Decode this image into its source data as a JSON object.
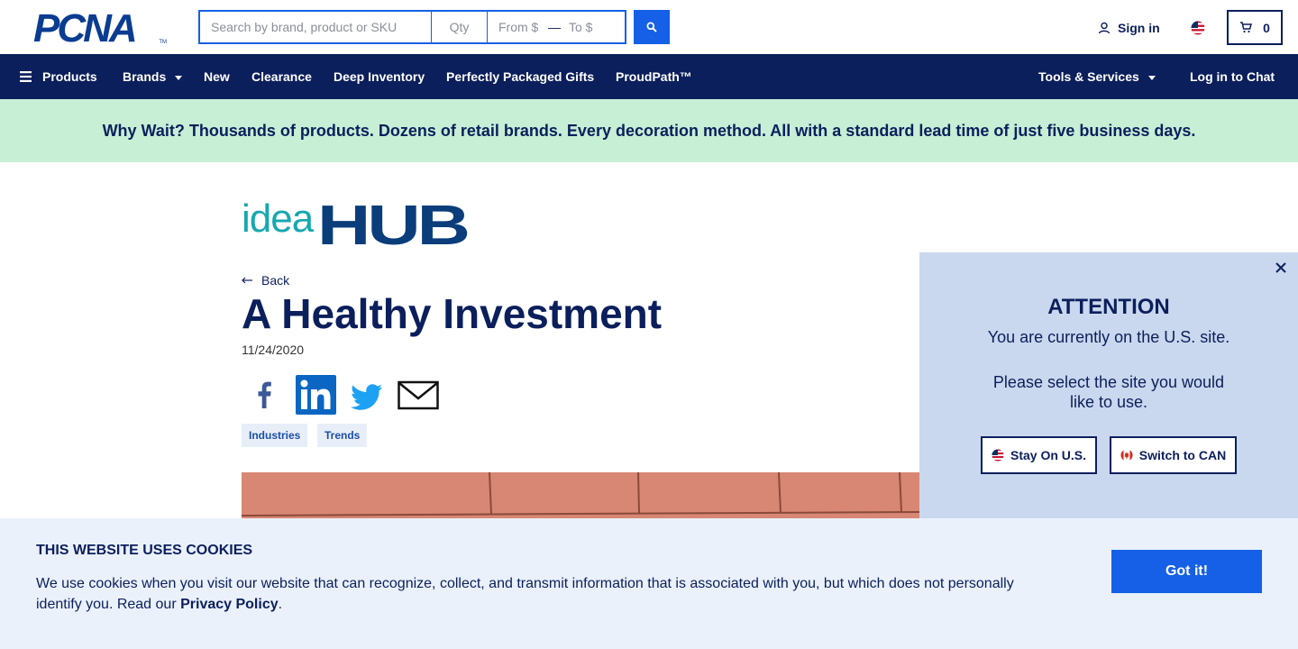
{
  "header": {
    "logo_text": "PCNA",
    "logo_tm": "TM",
    "search": {
      "placeholder": "Search by brand, product or SKU",
      "value": ""
    },
    "qty": {
      "placeholder": "Qty"
    },
    "price_from": {
      "placeholder": "From $"
    },
    "price_dash": "—",
    "price_to": {
      "placeholder": "To $"
    },
    "signin_label": "Sign in",
    "cart_count": "0"
  },
  "nav": {
    "items": [
      {
        "label": "Products"
      },
      {
        "label": "Brands"
      },
      {
        "label": "New"
      },
      {
        "label": "Clearance"
      },
      {
        "label": "Deep Inventory"
      },
      {
        "label": "Perfectly Packaged Gifts"
      },
      {
        "label": "ProudPath™"
      }
    ],
    "right_items": [
      {
        "label": "Tools & Services"
      },
      {
        "label": "Log in to Chat"
      }
    ]
  },
  "promo": {
    "text": "Why Wait? Thousands of products. Dozens of retail brands. Every decoration method. All with a standard lead time of just five business days."
  },
  "article": {
    "logo_left": "idea",
    "logo_right": "HUB",
    "back_label": "Back",
    "title": "A Healthy Investment",
    "date": "11/24/2020",
    "tags": [
      "Industries",
      "Trends"
    ]
  },
  "modal": {
    "title": "ATTENTION",
    "line1": "You are currently on the U.S. site.",
    "line2": "Please select the site you would like to use.",
    "stay_label": "Stay On U.S.",
    "switch_label": "Switch to CAN"
  },
  "cookie": {
    "title": "THIS WEBSITE USES COOKIES",
    "text": "We use cookies when you visit our website that can recognize, collect, and transmit information that is associated with you, but which does not personally identify you. Read our ",
    "link_label": "Privacy Policy",
    "text_end": ".",
    "button_label": "Got it!"
  },
  "colors": {
    "navy": "#0b1f5c",
    "accent_blue": "#1560e6",
    "promo_bg": "#c6efd5",
    "modal_bg": "#c9d8ee",
    "cookie_bg": "#eaf1fb",
    "idea_teal": "#17a8b0"
  }
}
